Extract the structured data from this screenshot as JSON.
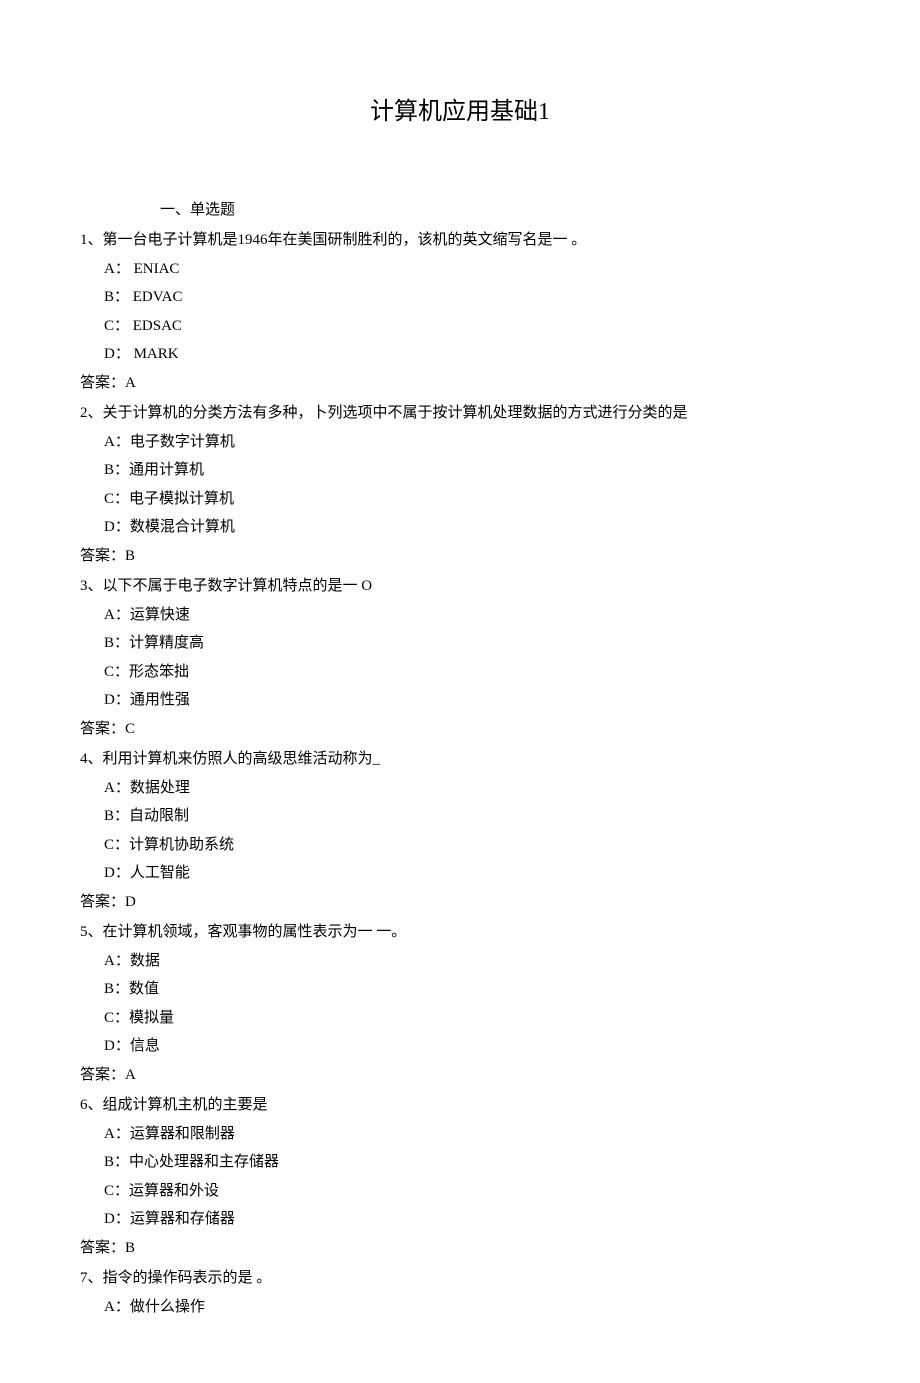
{
  "title": "计算机应用基础1",
  "section_header": "一、单选题",
  "questions": [
    {
      "number": "1",
      "text": "、第一台电子计算机是1946年在美国研制胜利的，该机的英文缩写名是一   。",
      "options": [
        "A：  ENIAC",
        "B：  EDVAC",
        "C：  EDSAC",
        "D：  MARK"
      ],
      "answer": "答案：A"
    },
    {
      "number": "2",
      "text": "、关于计算机的分类方法有多种，卜列选项中不属于按计算机处理数据的方式进行分类的是",
      "options": [
        "A：电子数字计算机",
        "B：通用计算机",
        "C：电子模拟计算机",
        "D：数模混合计算机"
      ],
      "answer": "答案：B"
    },
    {
      "number": "3",
      "text": "、以下不属于电子数字计算机特点的是一    O",
      "options": [
        "A：运算快速",
        "B：计算精度高",
        "C：形态笨拙",
        "D：通用性强"
      ],
      "answer": "答案：C"
    },
    {
      "number": "4",
      "text": "、利用计算机来仿照人的高级思维活动称为_",
      "options": [
        "A：数据处理",
        "B：自动限制",
        "C：计算机协助系统",
        "D：人工智能"
      ],
      "answer": "答案：D"
    },
    {
      "number": "5",
      "text": "、在计算机领域，客观事物的属性表示为一 一。",
      "options": [
        "A：数据",
        "B：数值",
        "C：模拟量",
        "D：信息"
      ],
      "answer": "答案：A"
    },
    {
      "number": "6",
      "text": "、组成计算机主机的主要是",
      "options": [
        "A：运算器和限制器",
        "B：中心处理器和主存储器",
        "C：运算器和外设",
        "D：运算器和存储器"
      ],
      "answer": "答案：B"
    },
    {
      "number": "7",
      "text": "、指令的操作码表示的是      。",
      "options": [
        "A：做什么操作"
      ],
      "answer": ""
    }
  ]
}
